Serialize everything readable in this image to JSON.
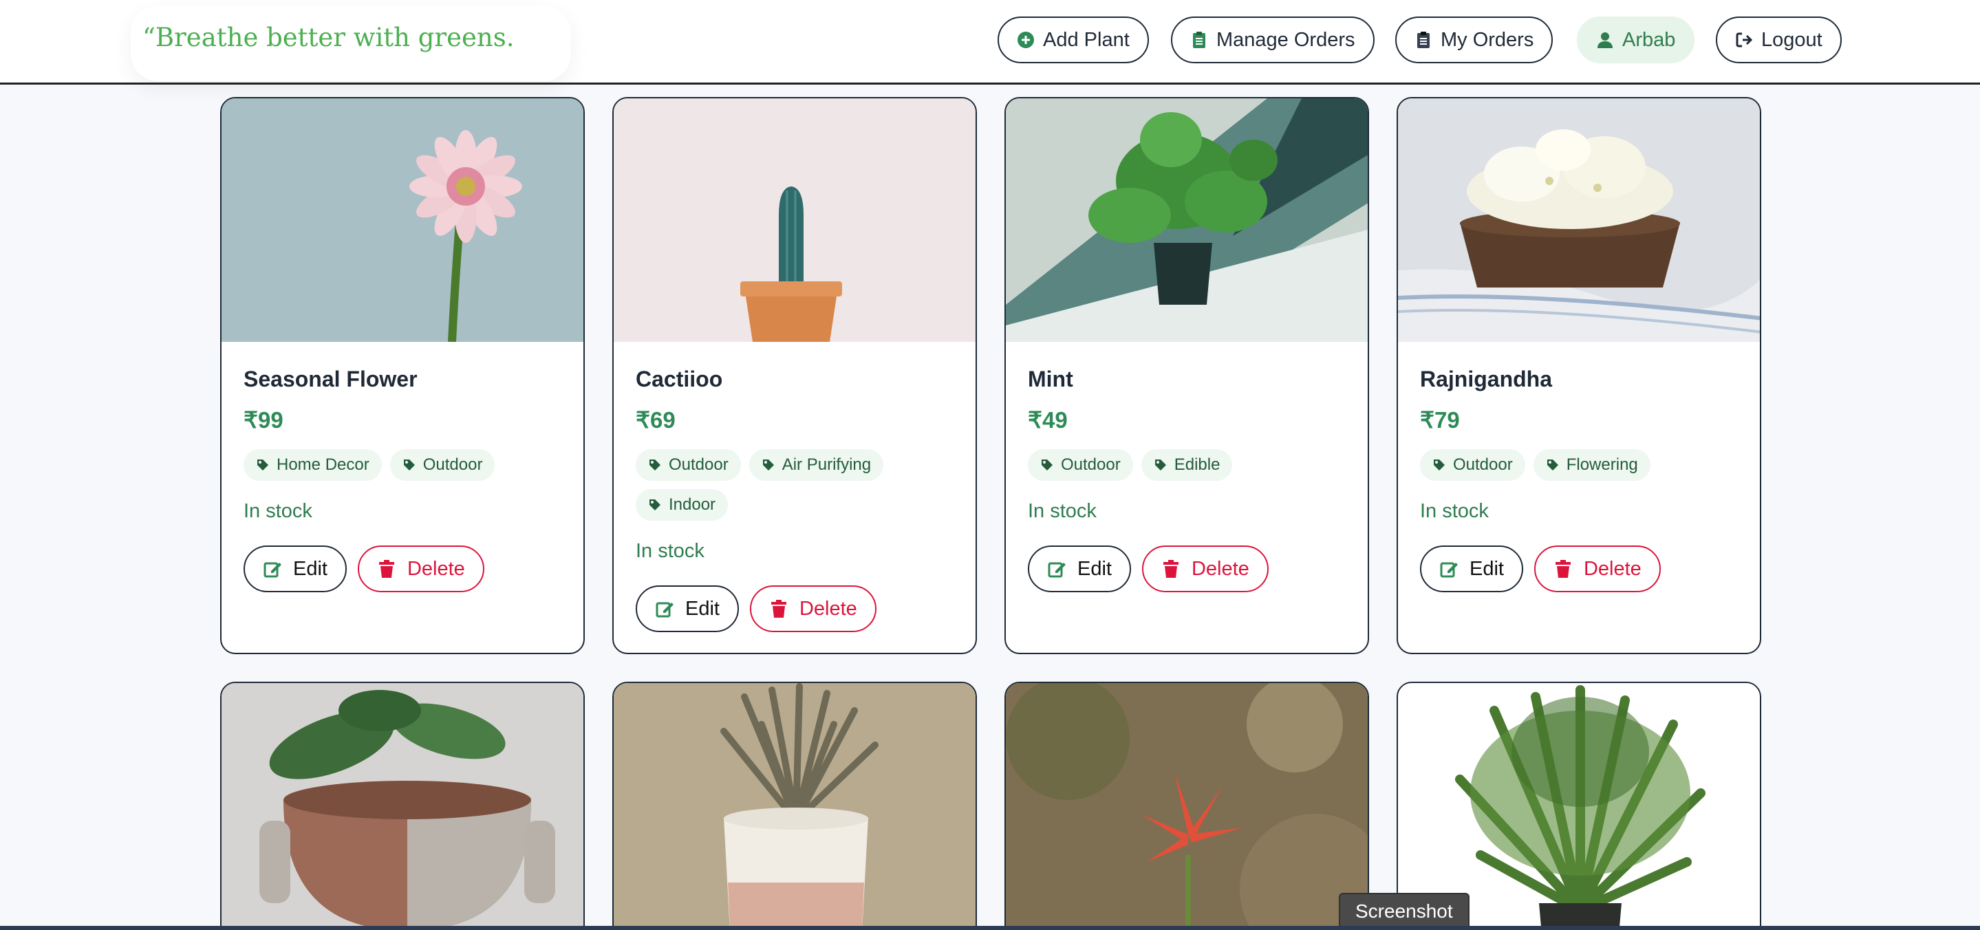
{
  "nav": {
    "tagline": "“Breathe better with greens.",
    "buttons": [
      "Add Plant",
      "Manage Orders",
      "My Orders",
      "Arbab",
      "Logout"
    ]
  },
  "plants": [
    {
      "name": "Seasonal Flower",
      "price": "₹99",
      "tags": [
        "Home Decor",
        "Outdoor"
      ],
      "stock": "In stock"
    },
    {
      "name": "Cactiioo",
      "price": "₹69",
      "tags": [
        "Outdoor",
        "Air Purifying",
        "Indoor"
      ],
      "stock": "In stock"
    },
    {
      "name": "Mint",
      "price": "₹49",
      "tags": [
        "Outdoor",
        "Edible"
      ],
      "stock": "In stock"
    },
    {
      "name": "Rajnigandha",
      "price": "₹79",
      "tags": [
        "Outdoor",
        "Flowering"
      ],
      "stock": "In stock"
    }
  ],
  "actions": {
    "edit_label": "Edit",
    "delete_label": "Delete"
  },
  "footer": {
    "screenshot_label": "Screenshot"
  },
  "colors": {
    "accent": "#2e8b57",
    "tagline": "#4caf50",
    "danger": "#dc143c"
  }
}
